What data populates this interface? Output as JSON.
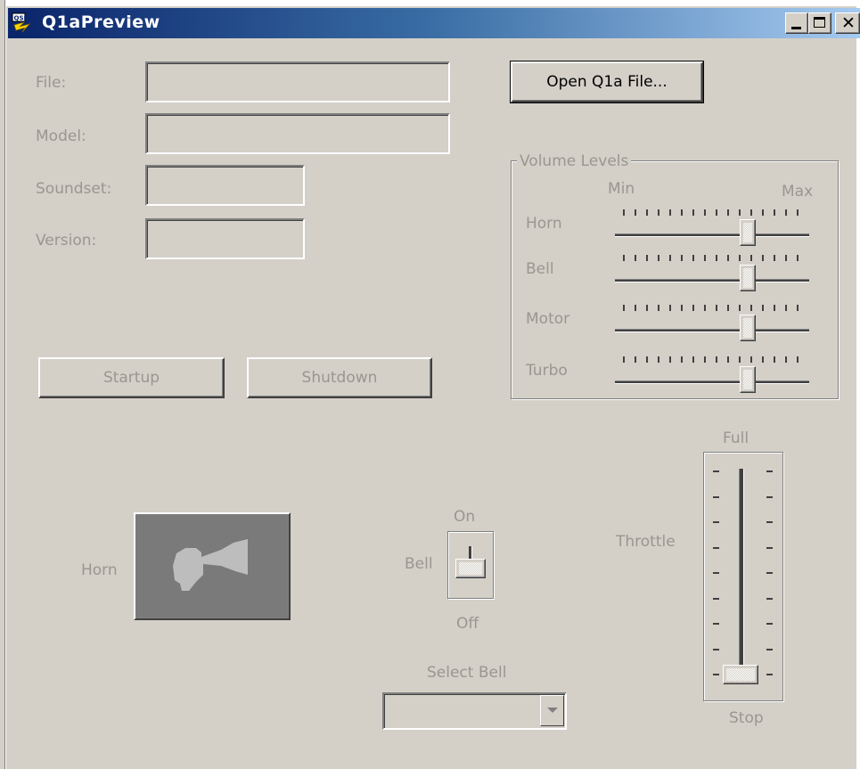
{
  "window": {
    "title": "Q1aPreview",
    "minimize_icon": "minimize-icon",
    "maximize_icon": "maximize-icon",
    "close_icon": "close-icon",
    "titlebar_color": "#0a246a"
  },
  "fields": {
    "file_label": "File:",
    "model_label": "Model:",
    "soundset_label": "Soundset:",
    "version_label": "Version:",
    "file_value": "",
    "model_value": "",
    "soundset_value": "",
    "version_value": ""
  },
  "buttons": {
    "open": "Open Q1a File...",
    "startup": "Startup",
    "shutdown": "Shutdown"
  },
  "volume": {
    "title": "Volume Levels",
    "min_label": "Min",
    "max_label": "Max",
    "sliders": [
      {
        "label": "Horn",
        "level": 0.72
      },
      {
        "label": "Bell",
        "level": 0.72
      },
      {
        "label": "Motor",
        "level": 0.72
      },
      {
        "label": "Turbo",
        "level": 0.72
      }
    ]
  },
  "horn": {
    "label": "Horn",
    "icon": "horn-icon"
  },
  "bell": {
    "label": "Bell",
    "on_label": "On",
    "off_label": "Off",
    "state": "on"
  },
  "select_bell": {
    "label": "Select Bell",
    "value": "",
    "arrow_icon": "chevron-down-icon"
  },
  "throttle": {
    "label": "Throttle",
    "full_label": "Full",
    "stop_label": "Stop",
    "level": 0
  }
}
